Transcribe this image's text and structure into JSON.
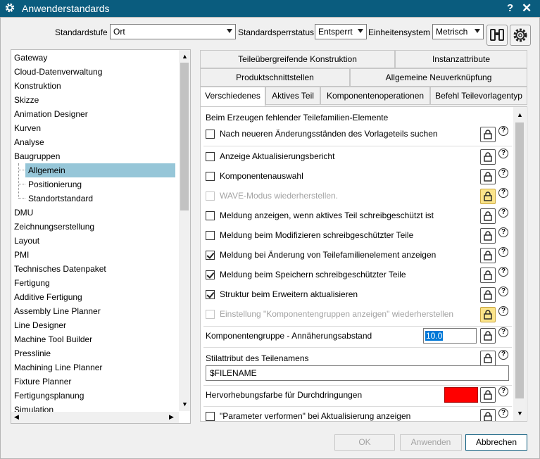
{
  "window": {
    "title": "Anwenderstandards",
    "help_label": "?",
    "close_label": "✕"
  },
  "toolbar": {
    "standardstufe_label": "Standardstufe",
    "standardstufe_value": "Ort",
    "sperrstatus_label": "Standardsperrstatus",
    "sperrstatus_value": "Entsperrt",
    "einheiten_label": "Einheitensystem",
    "einheiten_value": "Metrisch"
  },
  "tree": {
    "items": [
      {
        "label": "Gateway"
      },
      {
        "label": "Cloud-Datenverwaltung"
      },
      {
        "label": "Konstruktion"
      },
      {
        "label": "Skizze"
      },
      {
        "label": "Animation Designer"
      },
      {
        "label": "Kurven"
      },
      {
        "label": "Analyse"
      },
      {
        "label": "Baugruppen"
      },
      {
        "label": "Allgemein"
      },
      {
        "label": "Positionierung"
      },
      {
        "label": "Standortstandard"
      },
      {
        "label": "DMU"
      },
      {
        "label": "Zeichnungserstellung"
      },
      {
        "label": "Layout"
      },
      {
        "label": "PMI"
      },
      {
        "label": "Technisches Datenpaket"
      },
      {
        "label": "Fertigung"
      },
      {
        "label": "Additive Fertigung"
      },
      {
        "label": "Assembly Line Planner"
      },
      {
        "label": "Line Designer"
      },
      {
        "label": "Machine Tool Builder"
      },
      {
        "label": "Presslinie"
      },
      {
        "label": "Machining Line Planner"
      },
      {
        "label": "Fixture Planner"
      },
      {
        "label": "Fertigungsplanung"
      },
      {
        "label": "Simulation"
      }
    ]
  },
  "tabs": {
    "row1": [
      "Teileübergreifende Konstruktion",
      "Instanzattribute"
    ],
    "row2": [
      "Produktschnittstellen",
      "Allgemeine Neuverknüpfung"
    ],
    "row3": [
      "Verschiedenes",
      "Aktives Teil",
      "Komponentenoperationen",
      "Befehl Teilevorlagentyp"
    ],
    "active": "Verschiedenes"
  },
  "panel": {
    "section_title": "Beim Erzeugen fehlender Teilefamilien-Elemente",
    "options": [
      {
        "label": "Nach neueren Änderungsständen des Vorlageteils suchen",
        "checked": false,
        "disabled": false
      },
      {
        "label": "Anzeige Aktualisierungsbericht",
        "checked": false,
        "disabled": false
      },
      {
        "label": "Komponentenauswahl",
        "checked": false,
        "disabled": false
      },
      {
        "label": "WAVE-Modus wiederherstellen.",
        "checked": false,
        "disabled": true
      },
      {
        "label": "Meldung anzeigen, wenn aktives Teil schreibgeschützt ist",
        "checked": false,
        "disabled": false
      },
      {
        "label": "Meldung beim Modifizieren schreibgeschützter Teile",
        "checked": false,
        "disabled": false
      },
      {
        "label": "Meldung bei Änderung von Teilefamilienelement anzeigen",
        "checked": true,
        "disabled": false
      },
      {
        "label": "Meldung beim Speichern schreibgeschützter Teile",
        "checked": true,
        "disabled": false
      },
      {
        "label": "Struktur beim Erweitern aktualisieren",
        "checked": true,
        "disabled": false
      },
      {
        "label": "Einstellung \"Komponentengruppen anzeigen\" wiederherstellen",
        "checked": false,
        "disabled": true
      }
    ],
    "approach_label": "Komponentengruppe - Annäherungsabstand",
    "approach_value": "10.0",
    "style_attr_label": "Stilattribut des Teilenamens",
    "style_attr_value": "$FILENAME",
    "highlight_label": "Hervorhebungsfarbe für Durchdringungen",
    "highlight_color": "#ff0000",
    "last_option_label": "\"Parameter verformen\" bei Aktualisierung anzeigen",
    "help_symbol": "?"
  },
  "buttons": {
    "ok": "OK",
    "apply": "Anwenden",
    "cancel": "Abbrechen"
  }
}
